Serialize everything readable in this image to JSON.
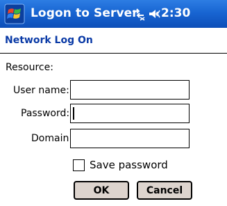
{
  "titlebar": {
    "start_icon": "windows-flag-icon",
    "title": "Logon to Server",
    "connectivity_icon": "connectivity-icon",
    "volume_icon": "speaker-icon",
    "time": "2:30"
  },
  "header": {
    "title": "Network Log On"
  },
  "form": {
    "resource_label": "Resource:",
    "username_label": "User name:",
    "username_value": "",
    "password_label": "Password:",
    "password_value": "",
    "domain_label": "Domain:",
    "domain_value": "",
    "save_password_label": "Save password",
    "save_password_checked": false
  },
  "buttons": {
    "ok": "OK",
    "cancel": "Cancel"
  },
  "colors": {
    "titlebar": "#1865d2",
    "header_text": "#0a3aa6",
    "button_face": "#ddd4ce"
  }
}
